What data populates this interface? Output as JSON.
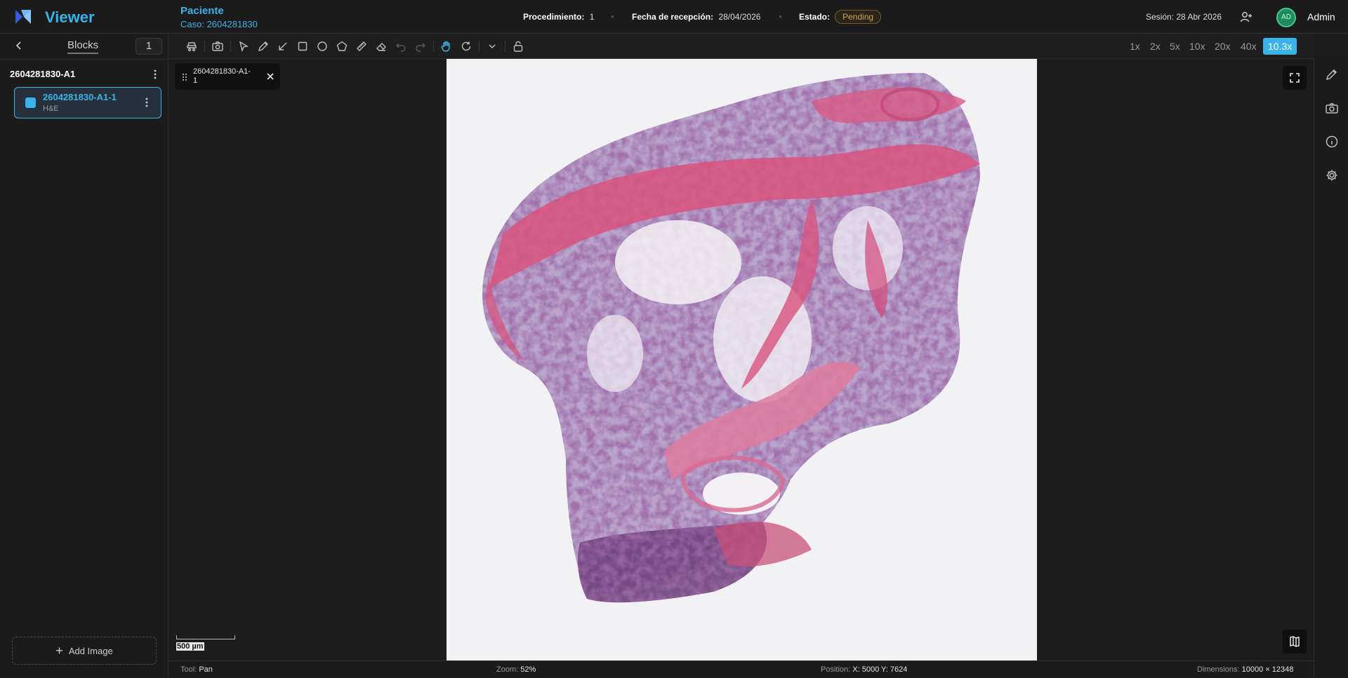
{
  "header": {
    "app_title": "Viewer",
    "patient_label": "Paciente",
    "case_label": "Caso: 2604281830",
    "procedure_label": "Procedimiento:",
    "procedure_value": "1",
    "reception_label": "Fecha de recepción:",
    "reception_value": "28/04/2026",
    "status_label": "Estado:",
    "status_value": "Pending",
    "session": "Sesión: 28 Abr 2026",
    "avatar_initials": "AD",
    "user_name": "Admin"
  },
  "sidebar": {
    "tab_label": "Blocks",
    "count": "1",
    "block_title": "2604281830-A1",
    "slides": [
      {
        "name": "2604281830-A1-1",
        "stain": "H&E"
      }
    ],
    "add_image_label": "Add Image"
  },
  "toolbar": {
    "zoom_levels": [
      "1x",
      "2x",
      "5x",
      "10x",
      "20x",
      "40x"
    ],
    "active_zoom": "10.3x"
  },
  "viewer": {
    "image_tab_label": "2604281830-A1-1",
    "scale_label": "500 µm"
  },
  "status_bar": {
    "tool_label": "Tool:",
    "tool_value": "Pan",
    "zoom_label": "Zoom:",
    "zoom_value": "52%",
    "position_label": "Position:",
    "position_value": "X: 5000 Y: 7624",
    "dimensions_label": "Dimensions:",
    "dimensions_value": "10000 × 12348"
  },
  "colors": {
    "accent": "#3ab3e8",
    "status_pending": "#c8a65a",
    "avatar": "#1f8a5c"
  },
  "icons": [
    "logo-icon",
    "add-user-icon",
    "back-icon",
    "more-vertical-icon",
    "slide-tray-icon",
    "camera-icon",
    "pointer-icon",
    "pencil-icon",
    "arrow-icon",
    "rectangle-icon",
    "circle-icon",
    "polygon-icon",
    "ruler-icon",
    "eraser-icon",
    "undo-icon",
    "redo-icon",
    "pan-hand-icon",
    "rotate-icon",
    "chevron-down-icon",
    "unlock-icon",
    "grip-icon",
    "close-icon",
    "fullscreen-icon",
    "map-icon",
    "info-icon",
    "gear-icon",
    "plus-icon"
  ]
}
